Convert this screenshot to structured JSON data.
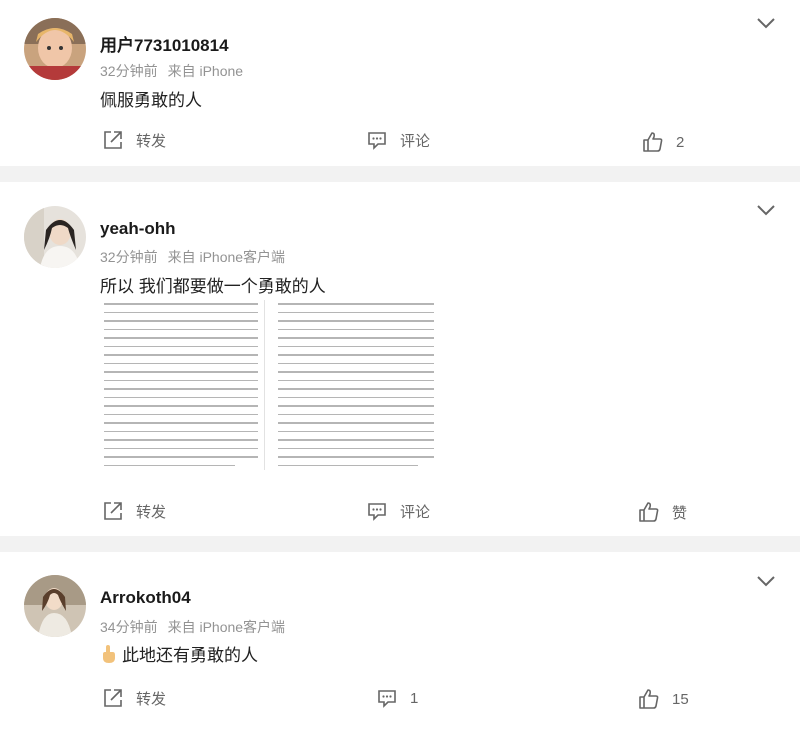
{
  "posts": [
    {
      "username": "用户7731010814",
      "time": "32分钟前",
      "source": "来自 iPhone",
      "text": "佩服勇敢的人",
      "actions": {
        "share": "转发",
        "comment": "评论",
        "like": "2"
      }
    },
    {
      "username": "yeah-ohh",
      "time": "32分钟前",
      "source": "来自 iPhone客户端",
      "text": "所以 我们都要做一个勇敢的人",
      "actions": {
        "share": "转发",
        "comment": "评论",
        "like": "赞"
      }
    },
    {
      "username": "Arrokoth04",
      "time": "34分钟前",
      "source": "来自 iPhone客户端",
      "text": "此地还有勇敢的人",
      "actions": {
        "share": "转发",
        "comment": "1",
        "like": "15"
      }
    }
  ],
  "icons": {
    "expand": "chevron-down-icon",
    "share": "share-icon",
    "comment": "comment-icon",
    "like": "thumb-up-icon"
  },
  "colors": {
    "page_bg": "#f2f2f2",
    "card_bg": "#ffffff",
    "meta": "#939393",
    "action": "#666666"
  }
}
